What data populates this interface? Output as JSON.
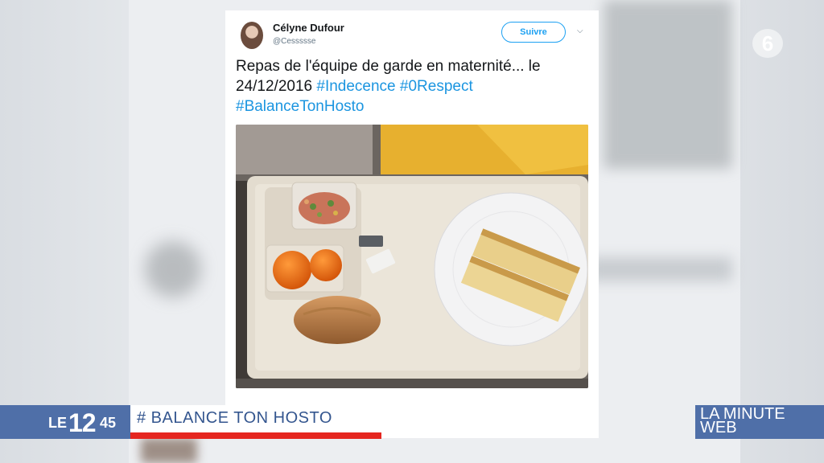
{
  "tweet": {
    "display_name": "Célyne Dufour",
    "handle": "@Cessssse",
    "follow_label": "Suivre",
    "text_line1": "Repas de l'équipe de garde en maternité... le",
    "text_line2_date": "24/12/2016",
    "hashtags_line2": [
      "#Indecence",
      "#0Respect"
    ],
    "hashtag_line3": "#BalanceTonHosto"
  },
  "broadcast": {
    "channel_logo": "6",
    "show_logo": {
      "le": "LE",
      "twelve": "12",
      "fortyfive": "45"
    },
    "headline": "# BALANCE TON HOSTO",
    "segment_line1": "LA MINUTE",
    "segment_line2": "WEB"
  },
  "icons": {
    "avatar": "user-avatar",
    "menu": "chevron-down-icon",
    "channel": "m6-logo-icon"
  },
  "colors": {
    "twitter_blue": "#1da1f2",
    "hashtag": "#1b95e0",
    "banner_blue": "#4f6fa8",
    "headline_text": "#34568f",
    "accent_red": "#e52620"
  }
}
